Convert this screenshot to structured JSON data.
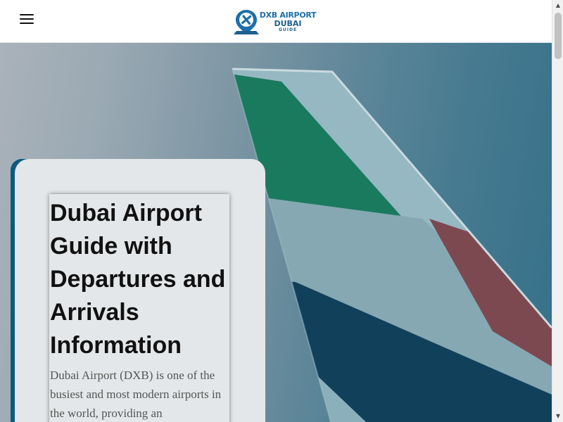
{
  "header": {
    "menu_icon": "hamburger-icon",
    "logo": {
      "icon": "airport-pin-icon",
      "line1": "DXB AIRPORT",
      "line2": "DUBAI",
      "line3": "GUIDE"
    }
  },
  "hero": {
    "title": "Dubai Airport Guide with Departures and Arrivals Information",
    "description": "Dubai Airport (DXB) is one of the busiest and most modern airports in the world, providing an",
    "background": "emirates-tail-fin-photo"
  },
  "colors": {
    "brand_blue": "#1d6fa8",
    "accent_teal": "#0d5a7e",
    "card_bg": "#e4e7e9"
  },
  "scrollbar": {
    "up_icon": "scroll-up-arrow-icon",
    "down_icon": "scroll-down-arrow-icon"
  }
}
